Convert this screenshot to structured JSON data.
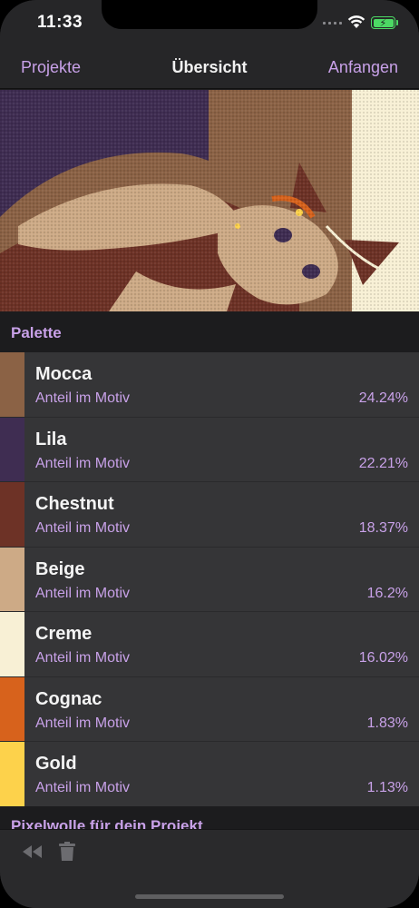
{
  "status": {
    "time": "11:33"
  },
  "nav": {
    "back_label": "Projekte",
    "title": "Übersicht",
    "action_label": "Anfangen"
  },
  "palette_header": "Palette",
  "colors": [
    {
      "name": "Mocca",
      "share_label": "Anteil im Motiv",
      "share": "24.24%",
      "hex": "#8b6245"
    },
    {
      "name": "Lila",
      "share_label": "Anteil im Motiv",
      "share": "22.21%",
      "hex": "#3f2d52"
    },
    {
      "name": "Chestnut",
      "share_label": "Anteil im Motiv",
      "share": "18.37%",
      "hex": "#6d3226"
    },
    {
      "name": "Beige",
      "share_label": "Anteil im Motiv",
      "share": "16.2%",
      "hex": "#cdaa86"
    },
    {
      "name": "Creme",
      "share_label": "Anteil im Motiv",
      "share": "16.02%",
      "hex": "#f8f0d5"
    },
    {
      "name": "Cognac",
      "share_label": "Anteil im Motiv",
      "share": "1.83%",
      "hex": "#d7621c"
    },
    {
      "name": "Gold",
      "share_label": "Anteil im Motiv",
      "share": "1.13%",
      "hex": "#fdd24b"
    }
  ],
  "next_section_header": "Pixelwolle für dein Projekt",
  "accent_color": "#c8a1e8",
  "icons": {
    "rewind": "rewind-icon",
    "trash": "trash-icon"
  }
}
